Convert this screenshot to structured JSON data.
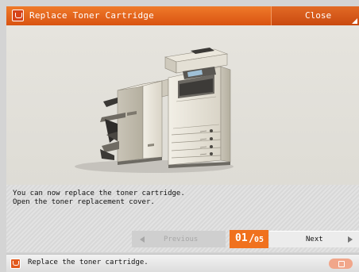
{
  "dialog": {
    "title": "Replace Toner Cartridge",
    "close_label": "Close"
  },
  "message": {
    "line1": "You can now replace the toner cartridge.",
    "line2": "Open the toner replacement cover."
  },
  "pager": {
    "previous_label": "Previous",
    "current_page": "01",
    "separator": "/",
    "total_pages": "05",
    "next_label": "Next"
  },
  "statusbar": {
    "text": "Replace the toner cartridge."
  },
  "colors": {
    "accent": "#e8661f",
    "title_bar": "#d95311",
    "page_indicator": "#f0711e"
  },
  "icons": {
    "title": "toner-warning-icon",
    "status": "toner-warning-icon",
    "previous": "arrow-left-icon",
    "next": "arrow-right-icon",
    "close": "corner-triangle-icon"
  }
}
